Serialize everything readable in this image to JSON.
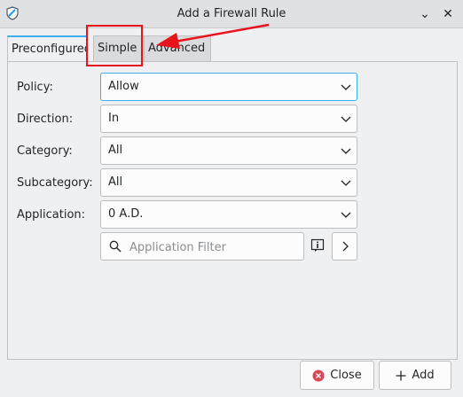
{
  "window": {
    "title": "Add a Firewall Rule",
    "minimize_glyph": "⌄",
    "close_glyph": "✕"
  },
  "tabs": [
    {
      "label": "Preconfigured",
      "active": true
    },
    {
      "label": "Simple",
      "active": false
    },
    {
      "label": "Advanced",
      "active": false
    }
  ],
  "form": {
    "policy": {
      "label": "Policy:",
      "value": "Allow"
    },
    "direction": {
      "label": "Direction:",
      "value": "In"
    },
    "category": {
      "label": "Category:",
      "value": "All"
    },
    "subcategory": {
      "label": "Subcategory:",
      "value": "All"
    },
    "application": {
      "label": "Application:",
      "value": "0 A.D."
    },
    "filter": {
      "placeholder": "Application Filter",
      "value": ""
    }
  },
  "footer": {
    "close_label": "Close",
    "add_label": "Add"
  },
  "colors": {
    "accent": "#3daee9",
    "annotation": "#e8141b",
    "close_icon": "#da4453"
  },
  "annotation": {
    "type": "highlight-with-arrow",
    "target": "tab-simple"
  }
}
